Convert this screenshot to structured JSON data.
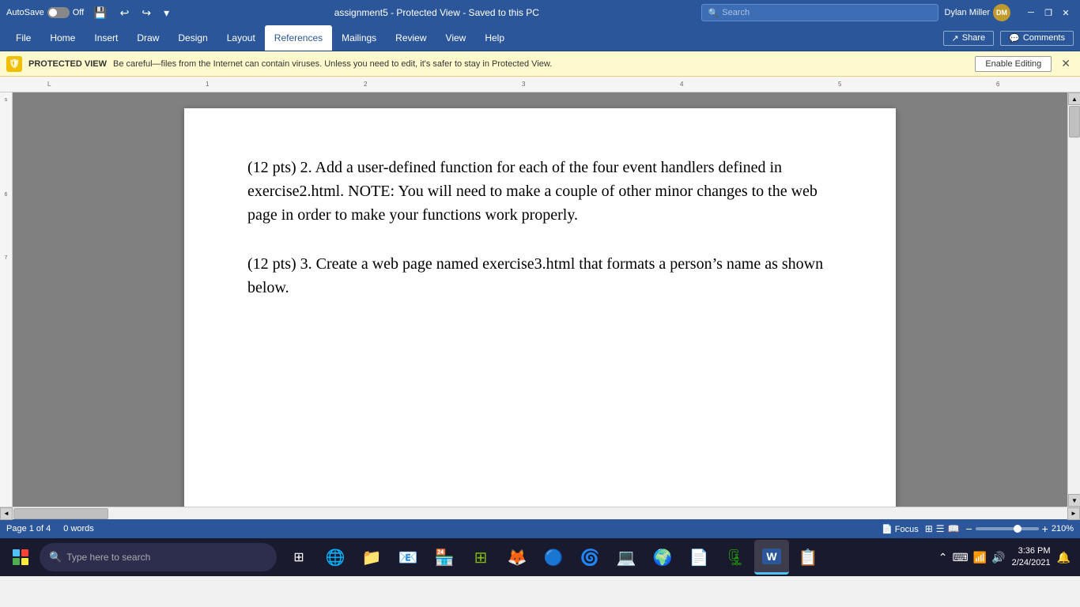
{
  "titlebar": {
    "autosave_label": "AutoSave",
    "autosave_state": "Off",
    "title": "assignment5  -  Protected View  -  Saved to this PC",
    "search_placeholder": "Search",
    "user_name": "Dylan Miller",
    "user_initials": "DM",
    "minimize": "─",
    "restore": "❐",
    "close": "✕"
  },
  "ribbon": {
    "tabs": [
      "File",
      "Home",
      "Insert",
      "Draw",
      "Design",
      "Layout",
      "References",
      "Mailings",
      "Review",
      "View",
      "Help"
    ],
    "active_tab": "References",
    "share_label": "Share",
    "comments_label": "Comments"
  },
  "protected_view": {
    "label": "PROTECTED VIEW",
    "message": "Be careful—files from the Internet can contain viruses. Unless you need to edit, it's safer to stay in Protected View.",
    "button_label": "Enable Editing"
  },
  "document": {
    "paragraph1": "(12 pts) 2. Add a user-defined function for each of the four event handlers defined in exercise2.html. NOTE: You will need to make a couple of other minor changes to the web page in order to make your functions work properly.",
    "paragraph2": "(12 pts) 3. Create a web page named exercise3.html that formats a person’s name as shown below."
  },
  "status_bar": {
    "page_info": "Page 1 of 4",
    "words": "0 words",
    "focus_label": "Focus",
    "zoom_level": "210%"
  },
  "taskbar": {
    "search_placeholder": "Type here to search",
    "time": "3:36 PM",
    "date": "2/24/2021"
  }
}
